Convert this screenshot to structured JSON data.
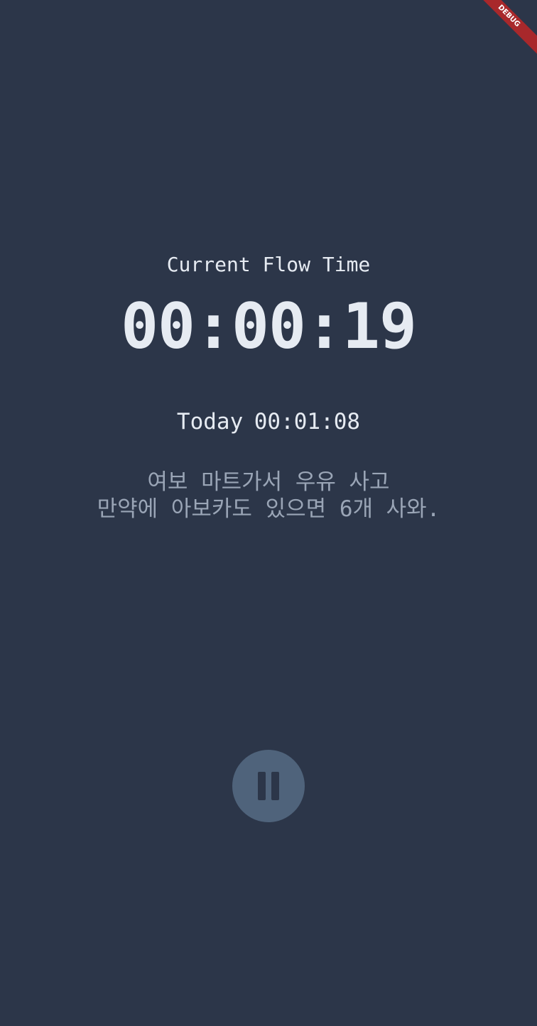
{
  "debug_banner": {
    "label": "DEBUG",
    "color": "#a8282b"
  },
  "timer": {
    "label": "Current Flow Time",
    "value": "00:00:19"
  },
  "today": {
    "prefix": "Today",
    "value": "00:01:08"
  },
  "memo": {
    "lines": [
      "여보 마트가서 우유 사고",
      "만약에 아보카도 있으면 6개 사와."
    ]
  },
  "controls": {
    "pause_icon": "pause-icon",
    "button_color": "#4f637b"
  },
  "colors": {
    "background": "#2c3649",
    "primary_text": "#e6ebf2",
    "secondary_text": "#9aa5b6"
  }
}
